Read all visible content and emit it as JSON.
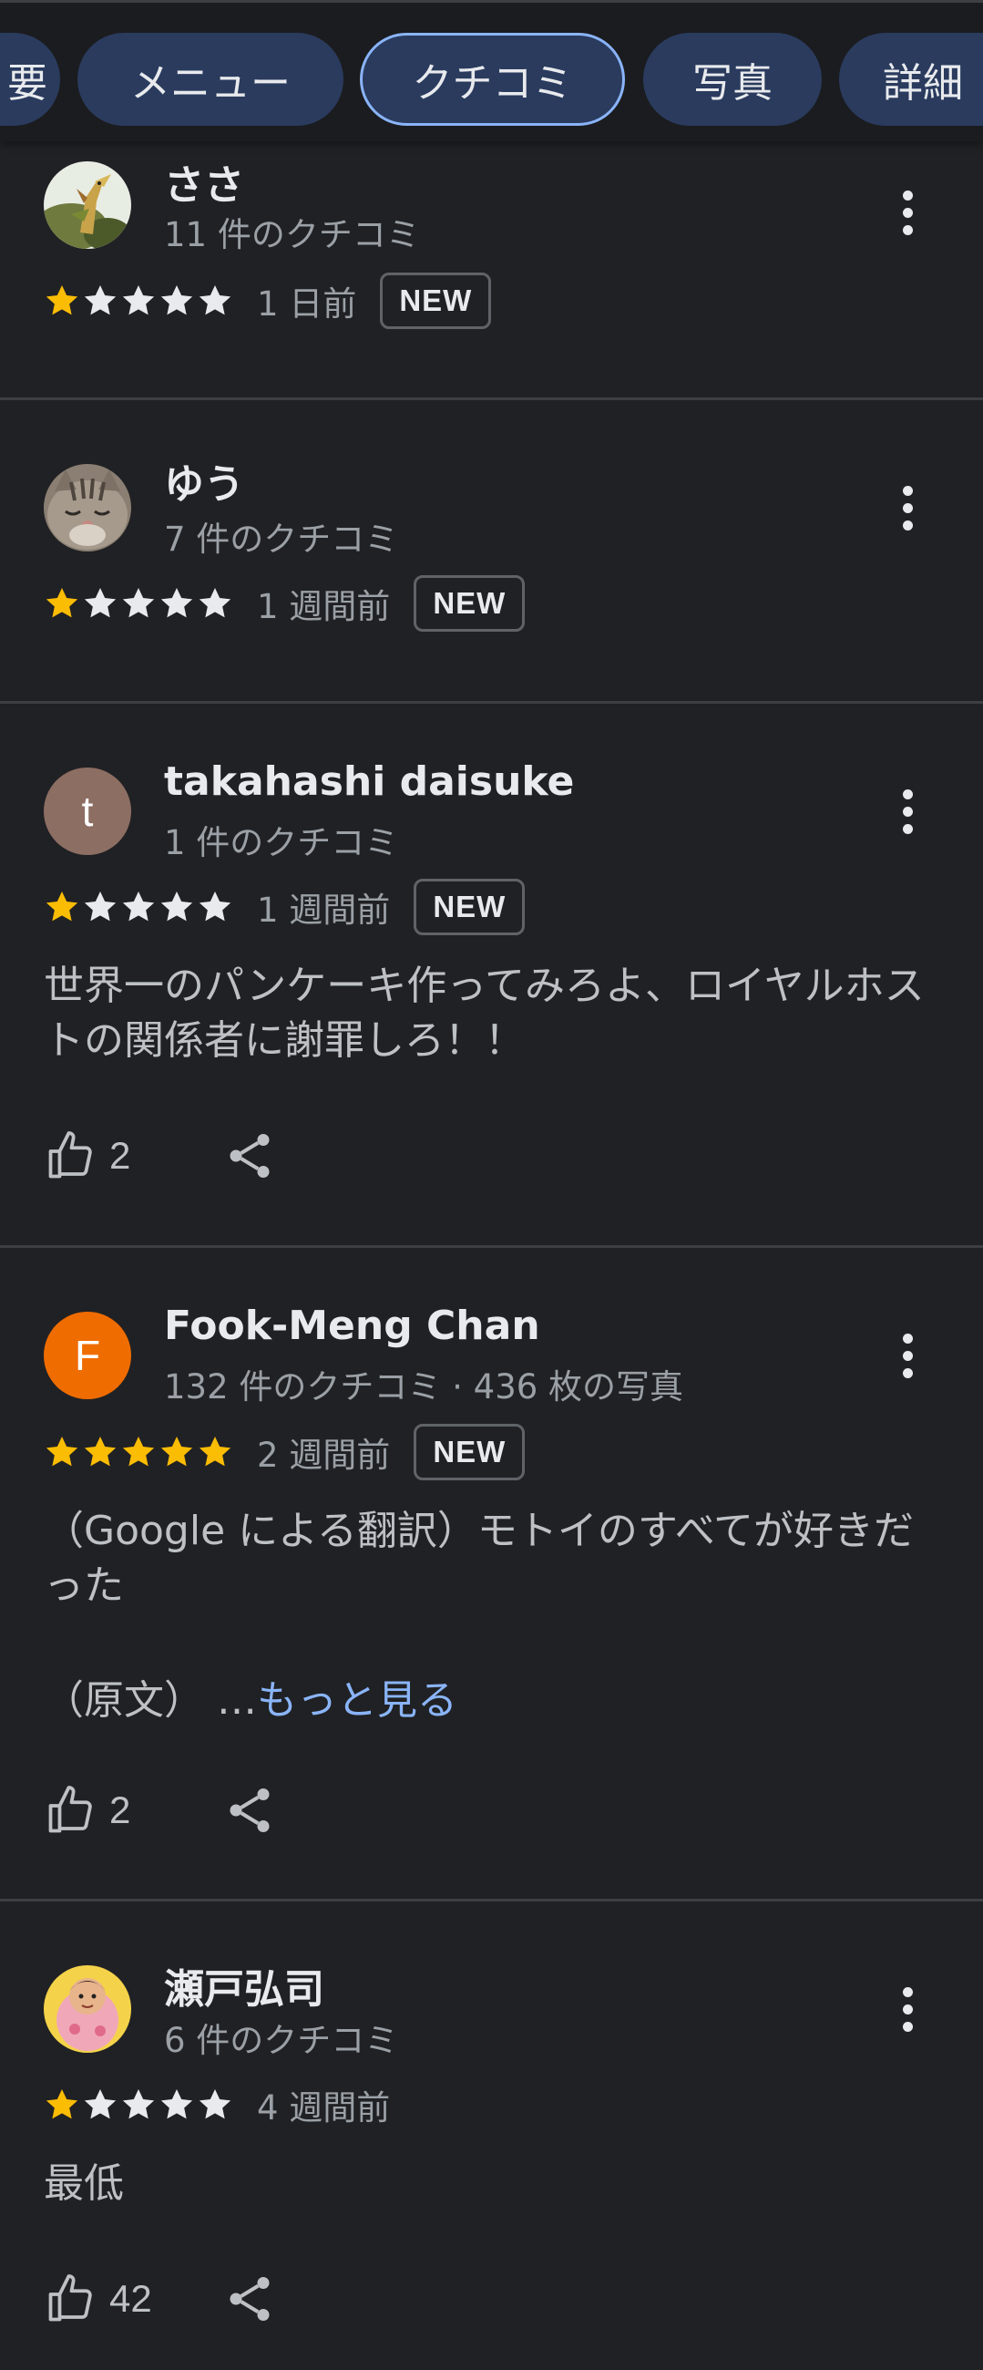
{
  "tabs": {
    "partial_label": "要",
    "menu_label": "メニュー",
    "reviews_label": "クチコミ",
    "photos_label": "写真",
    "details_label": "詳細"
  },
  "colors": {
    "background": "#202124",
    "tab_background": "#2a3b5e",
    "active_tab_border": "#8ab4f8",
    "star_filled": "#fbbc04",
    "star_empty": "#e8eaed",
    "link": "#8ab4f8",
    "avatar_t": "#8d6e63",
    "avatar_f": "#ef6c00"
  },
  "reviews": [
    {
      "name": "ささ",
      "subline": "11 件のクチコミ",
      "rating": 1,
      "time": "1 日前",
      "badge": "NEW",
      "avatar_icon": "photo-avatar-bird"
    },
    {
      "name": "ゆう",
      "subline": "7 件のクチコミ",
      "rating": 1,
      "time": "1 週間前",
      "badge": "NEW",
      "avatar_icon": "photo-avatar-cat"
    },
    {
      "name": "takahashi daisuke",
      "subline": "1 件のクチコミ",
      "rating": 1,
      "time": "1 週間前",
      "badge": "NEW",
      "avatar_letter": "t",
      "text": "世界一のパンケーキ作ってみろよ、ロイヤルホストの関係者に謝罪しろ！！",
      "likes": "2"
    },
    {
      "name": "Fook-Meng Chan",
      "subline": "132 件のクチコミ · 436 枚の写真",
      "rating": 5,
      "time": "2 週間前",
      "badge": "NEW",
      "avatar_letter": "F",
      "text": "（Google による翻訳）モトイのすべてが好きだった",
      "original_prefix": "（原文） …",
      "more_label": "もっと見る",
      "likes": "2"
    },
    {
      "name": "瀬戸弘司",
      "subline": "6 件のクチコミ",
      "rating": 1,
      "time": "4 週間前",
      "avatar_icon": "photo-avatar-person",
      "text": "最低",
      "likes": "42"
    }
  ]
}
